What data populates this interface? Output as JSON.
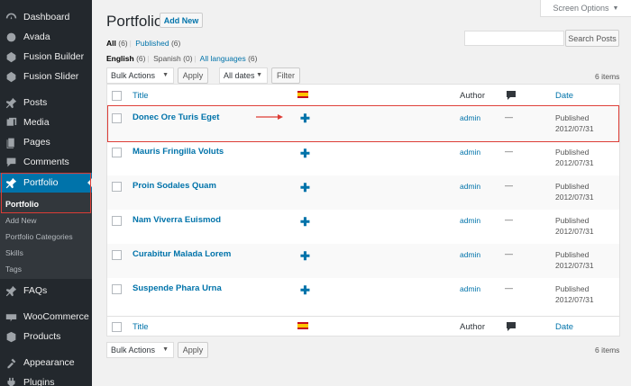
{
  "sidebar": {
    "items": [
      {
        "label": "Dashboard",
        "icon": "dashboard-icon"
      },
      {
        "label": "Avada",
        "icon": "avada-icon"
      },
      {
        "label": "Fusion Builder",
        "icon": "fusion-builder-icon"
      },
      {
        "label": "Fusion Slider",
        "icon": "fusion-slider-icon"
      },
      {
        "label": "Posts",
        "icon": "pin-icon"
      },
      {
        "label": "Media",
        "icon": "media-icon"
      },
      {
        "label": "Pages",
        "icon": "pages-icon"
      },
      {
        "label": "Comments",
        "icon": "comments-icon"
      },
      {
        "label": "Portfolio",
        "icon": "pin-icon"
      },
      {
        "label": "FAQs",
        "icon": "pin-icon"
      },
      {
        "label": "WooCommerce",
        "icon": "woocommerce-icon"
      },
      {
        "label": "Products",
        "icon": "products-icon"
      },
      {
        "label": "Appearance",
        "icon": "appearance-icon"
      },
      {
        "label": "Plugins",
        "icon": "plugins-icon"
      }
    ],
    "submenu": [
      "Portfolio",
      "Add New",
      "Portfolio Categories",
      "Skills",
      "Tags"
    ]
  },
  "header": {
    "title": "Portfolio",
    "add_new": "Add New",
    "screen_options": "Screen Options"
  },
  "views": {
    "all": "All",
    "all_count": "(6)",
    "published": "Published",
    "published_count": "(6)"
  },
  "languages": {
    "english": "English",
    "english_count": "(6)",
    "spanish": "Spanish",
    "spanish_count": "(0)",
    "all": "All languages",
    "all_count": "(6)"
  },
  "search": {
    "button": "Search Posts",
    "value": ""
  },
  "filters": {
    "bulk_actions": "Bulk Actions",
    "apply": "Apply",
    "all_dates": "All dates",
    "filter": "Filter",
    "items_count": "6 items"
  },
  "table": {
    "columns": {
      "title": "Title",
      "author": "Author",
      "date": "Date"
    },
    "rows": [
      {
        "title": "Donec Ore Turis Eget",
        "author": "admin",
        "comments": "—",
        "status": "Published",
        "date": "2012/07/31"
      },
      {
        "title": "Mauris Fringilla Voluts",
        "author": "admin",
        "comments": "—",
        "status": "Published",
        "date": "2012/07/31"
      },
      {
        "title": "Proin Sodales Quam",
        "author": "admin",
        "comments": "—",
        "status": "Published",
        "date": "2012/07/31"
      },
      {
        "title": "Nam Viverra Euismod",
        "author": "admin",
        "comments": "—",
        "status": "Published",
        "date": "2012/07/31"
      },
      {
        "title": "Curabitur Malada Lorem",
        "author": "admin",
        "comments": "—",
        "status": "Published",
        "date": "2012/07/31"
      },
      {
        "title": "Suspende Phara Urna",
        "author": "admin",
        "comments": "—",
        "status": "Published",
        "date": "2012/07/31"
      }
    ]
  },
  "bottom": {
    "bulk_actions": "Bulk Actions",
    "apply": "Apply",
    "items_count": "6 items"
  },
  "colors": {
    "accent": "#0073aa",
    "sidebar": "#23282d",
    "highlight": "#dd3d36"
  }
}
